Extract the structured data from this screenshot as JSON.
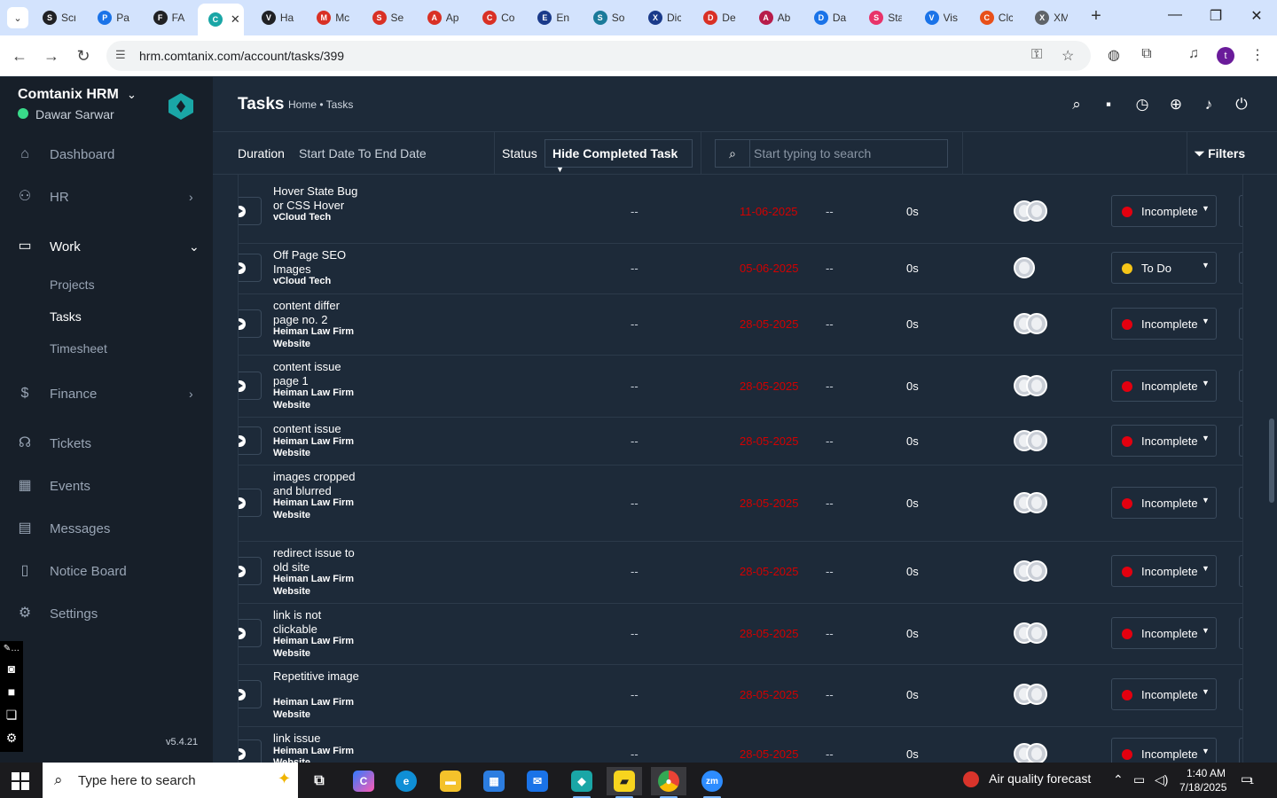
{
  "browser": {
    "tabs": [
      {
        "label": "Scr",
        "color": "#202124",
        "letter": "S"
      },
      {
        "label": "Pa",
        "color": "#1a73e8",
        "letter": "P"
      },
      {
        "label": "FA",
        "color": "#202124",
        "letter": "F"
      },
      {
        "label": "",
        "color": "#1aa6a6",
        "letter": "C",
        "active": true
      },
      {
        "label": "Ha",
        "color": "#202124",
        "letter": "V"
      },
      {
        "label": "Mc",
        "color": "#d93025",
        "letter": "M"
      },
      {
        "label": "Se",
        "color": "#d93025",
        "letter": "S"
      },
      {
        "label": "Ap",
        "color": "#d93025",
        "letter": "A"
      },
      {
        "label": "Co",
        "color": "#d93025",
        "letter": "C"
      },
      {
        "label": "En",
        "color": "#1a3a8a",
        "letter": "E"
      },
      {
        "label": "So",
        "color": "#1a7a9a",
        "letter": "S"
      },
      {
        "label": "Dic",
        "color": "#1a3a8a",
        "letter": "X"
      },
      {
        "label": "De",
        "color": "#d93025",
        "letter": "D"
      },
      {
        "label": "Ab",
        "color": "#b71c4a",
        "letter": "A"
      },
      {
        "label": "Da",
        "color": "#1a73e8",
        "letter": "D"
      },
      {
        "label": "Sta",
        "color": "#e8336a",
        "letter": "S"
      },
      {
        "label": "Vis",
        "color": "#1a73e8",
        "letter": "V"
      },
      {
        "label": "Clc",
        "color": "#e8501a",
        "letter": "C"
      },
      {
        "label": "XM",
        "color": "#5f6368",
        "letter": "X"
      }
    ],
    "url": "hrm.comtanix.com/account/tasks/399",
    "profile_initial": "t"
  },
  "sidebar": {
    "brand": "Comtanix HRM",
    "user": "Dawar Sarwar",
    "version": "v5.4.21",
    "items": [
      {
        "label": "Dashboard",
        "icon": "home-icon"
      },
      {
        "label": "HR",
        "icon": "users-icon"
      },
      {
        "label": "Work",
        "icon": "briefcase-icon"
      },
      {
        "label": "Finance",
        "icon": "dollar-icon"
      },
      {
        "label": "Tickets",
        "icon": "headset-icon"
      },
      {
        "label": "Events",
        "icon": "calendar-icon"
      },
      {
        "label": "Messages",
        "icon": "message-icon"
      },
      {
        "label": "Notice Board",
        "icon": "clipboard-icon"
      },
      {
        "label": "Settings",
        "icon": "gear-icon"
      }
    ],
    "work_sub": [
      "Projects",
      "Tasks",
      "Timesheet"
    ]
  },
  "header": {
    "title": "Tasks",
    "breadcrumb": "Home • Tasks"
  },
  "filters": {
    "duration_label": "Duration",
    "duration_value": "Start Date To End Date",
    "status_label": "Status",
    "status_value": "Hide Completed Task",
    "search_placeholder": "Start typing to search",
    "filters_label": "Filters"
  },
  "colors": {
    "incomplete": "#e3000f",
    "todo": "#f5c518",
    "due_date": "#d30000"
  },
  "tasks": [
    {
      "name": "Hover State Bug or CSS Hover",
      "project": "vCloud Tech",
      "start": "--",
      "due": "11-06-2025",
      "estimate": "--",
      "hours": "0s",
      "avatars": 2,
      "status": "Incomplete"
    },
    {
      "name": "Off Page SEO Images",
      "project": "vCloud Tech",
      "start": "--",
      "due": "05-06-2025",
      "estimate": "--",
      "hours": "0s",
      "avatars": 1,
      "status": "To Do"
    },
    {
      "name": "content differ page no. 2",
      "project": "Heiman Law Firm Website",
      "start": "--",
      "due": "28-05-2025",
      "estimate": "--",
      "hours": "0s",
      "avatars": 2,
      "status": "Incomplete"
    },
    {
      "name": "content issue page 1",
      "project": "Heiman Law Firm Website",
      "start": "--",
      "due": "28-05-2025",
      "estimate": "--",
      "hours": "0s",
      "avatars": 2,
      "status": "Incomplete"
    },
    {
      "name": "content issue",
      "project": "Heiman Law Firm Website",
      "start": "--",
      "due": "28-05-2025",
      "estimate": "--",
      "hours": "0s",
      "avatars": 2,
      "status": "Incomplete"
    },
    {
      "name": "images cropped and blurred",
      "project": "Heiman Law Firm Website",
      "start": "--",
      "due": "28-05-2025",
      "estimate": "--",
      "hours": "0s",
      "avatars": 2,
      "status": "Incomplete"
    },
    {
      "name": "redirect issue to old site",
      "project": "Heiman Law Firm Website",
      "start": "--",
      "due": "28-05-2025",
      "estimate": "--",
      "hours": "0s",
      "avatars": 2,
      "status": "Incomplete"
    },
    {
      "name": "link is not clickable",
      "project": "Heiman Law Firm Website",
      "start": "--",
      "due": "28-05-2025",
      "estimate": "--",
      "hours": "0s",
      "avatars": 2,
      "status": "Incomplete"
    },
    {
      "name": "Repetitive image",
      "project": "Heiman Law Firm Website",
      "start": "--",
      "due": "28-05-2025",
      "estimate": "--",
      "hours": "0s",
      "avatars": 2,
      "status": "Incomplete"
    },
    {
      "name": "link issue",
      "project": "Heiman Law Firm Website",
      "start": "--",
      "due": "28-05-2025",
      "estimate": "--",
      "hours": "0s",
      "avatars": 2,
      "status": "Incomplete"
    }
  ],
  "taskbar": {
    "search_placeholder": "Type here to search",
    "weather": "Air quality forecast",
    "time": "1:40 AM",
    "date": "7/18/2025",
    "notifications": "1"
  }
}
